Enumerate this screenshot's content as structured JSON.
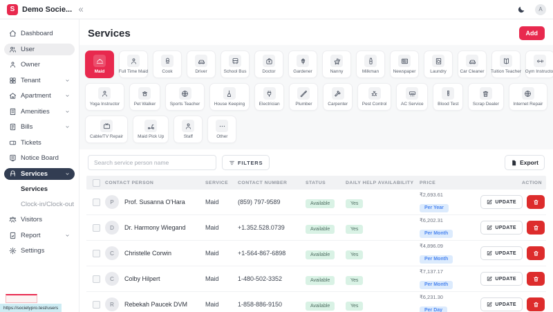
{
  "colors": {
    "brand": "#e8294e",
    "navy": "#323d52",
    "del": "#dd2c2c",
    "green_bg": "#d9f2e5",
    "green_tx": "#4f6e62",
    "blue_bg": "#dcebfd",
    "blue_tx": "#4c86f0",
    "tooltip_bg": "#cdecf3",
    "header_bg": "#f1f2f4"
  },
  "topbar": {
    "logo_letter": "S",
    "app_name": "Demo Socie...",
    "avatar_initial": "A"
  },
  "sidebar": {
    "items": [
      {
        "label": "Dashboard",
        "glyph": "i-home"
      },
      {
        "label": "User",
        "glyph": "i-users",
        "state": "highlight"
      },
      {
        "label": "Owner",
        "glyph": "i-user"
      },
      {
        "label": "Tenant",
        "glyph": "i-grid",
        "chevron": true
      },
      {
        "label": "Apartment",
        "glyph": "i-house",
        "chevron": true
      },
      {
        "label": "Amenities",
        "glyph": "i-building",
        "chevron": true
      },
      {
        "label": "Bills",
        "glyph": "i-doc",
        "chevron": true
      },
      {
        "label": "Tickets",
        "glyph": "i-ticket"
      },
      {
        "label": "Notice Board",
        "glyph": "i-board"
      },
      {
        "label": "Services",
        "glyph": "i-bench",
        "chevron": true,
        "state": "active",
        "children": [
          {
            "label": "Services",
            "active": true
          },
          {
            "label": "Clock-in/Clock-out"
          }
        ]
      },
      {
        "label": "Visitors",
        "glyph": "i-visitors"
      },
      {
        "label": "Report",
        "glyph": "i-report",
        "chevron": true
      },
      {
        "label": "Settings",
        "glyph": "i-gear"
      }
    ],
    "url_tooltip": "https://societypro.test/users"
  },
  "page": {
    "title": "Services",
    "add_button": "Add"
  },
  "service_tiles": {
    "active": "Maid",
    "rows": [
      [
        {
          "label": "Maid",
          "glyph": "i-cloche",
          "active": true
        },
        {
          "label": "Full Time Maid",
          "glyph": "i-user"
        },
        {
          "label": "Cook",
          "glyph": "i-hat"
        },
        {
          "label": "Driver",
          "glyph": "i-car"
        },
        {
          "label": "School Bus",
          "glyph": "i-bus"
        },
        {
          "label": "Doctor",
          "glyph": "i-bag"
        },
        {
          "label": "Gardener",
          "glyph": "i-flower"
        },
        {
          "label": "Nanny",
          "glyph": "i-pram"
        },
        {
          "label": "Milkman",
          "glyph": "i-bottle"
        },
        {
          "label": "Newspaper",
          "glyph": "i-news"
        },
        {
          "label": "Laundry",
          "glyph": "i-washer"
        },
        {
          "label": "Car Cleaner",
          "glyph": "i-car"
        },
        {
          "label": "Tuition Teacher",
          "glyph": "i-book"
        },
        {
          "label": "Gym Instructor",
          "glyph": "i-dumbbell"
        }
      ],
      [
        {
          "label": "Yoga Instructor",
          "glyph": "i-user"
        },
        {
          "label": "Pet Walker",
          "glyph": "i-paw"
        },
        {
          "label": "Sports Teacher",
          "glyph": "i-globe"
        },
        {
          "label": "House Keeping",
          "glyph": "i-broom"
        },
        {
          "label": "Electrician",
          "glyph": "i-plug"
        },
        {
          "label": "Plumber",
          "glyph": "i-wrench"
        },
        {
          "label": "Carpenter",
          "glyph": "i-hammer"
        },
        {
          "label": "Pest Control",
          "glyph": "i-bug"
        },
        {
          "label": "AC Service",
          "glyph": "i-ac"
        },
        {
          "label": "Blood Test",
          "glyph": "i-tube"
        },
        {
          "label": "Scrap Dealer",
          "glyph": "i-bin"
        },
        {
          "label": "Internet Repair",
          "glyph": "i-globe"
        }
      ],
      [
        {
          "label": "Cable/TV Repair",
          "glyph": "i-tv"
        },
        {
          "label": "Maid Pick Up",
          "glyph": "i-scooter"
        },
        {
          "label": "Staff",
          "glyph": "i-user"
        },
        {
          "label": "Other",
          "glyph": "i-dots"
        }
      ]
    ]
  },
  "toolbar": {
    "search_placeholder": "Search service person name",
    "filters_label": "FILTERS",
    "export_label": "Export"
  },
  "table": {
    "headers": [
      "CONTACT PERSON",
      "SERVICE",
      "CONTACT NUMBER",
      "STATUS",
      "DAILY HELP AVAILABILITY",
      "PRICE",
      "ACTION"
    ],
    "update_label": "UPDATE",
    "rows": [
      {
        "initial": "P",
        "name": "Prof. Susanna O'Hara",
        "service": "Maid",
        "contact": "(859) 797-9589",
        "status": "Available",
        "daily_help": "Yes",
        "price": "₹2,693.61",
        "period": "Per Year"
      },
      {
        "initial": "D",
        "name": "Dr. Harmony Wiegand",
        "service": "Maid",
        "contact": "+1.352.528.0739",
        "status": "Available",
        "daily_help": "Yes",
        "price": "₹6,202.31",
        "period": "Per Month"
      },
      {
        "initial": "C",
        "name": "Christelle Corwin",
        "service": "Maid",
        "contact": "+1-564-867-6898",
        "status": "Available",
        "daily_help": "Yes",
        "price": "₹4,896.09",
        "period": "Per Month"
      },
      {
        "initial": "C",
        "name": "Colby Hilpert",
        "service": "Maid",
        "contact": "1-480-502-3352",
        "status": "Available",
        "daily_help": "Yes",
        "price": "₹7,137.17",
        "period": "Per Month"
      },
      {
        "initial": "R",
        "name": "Rebekah Paucek DVM",
        "service": "Maid",
        "contact": "1-858-886-9150",
        "status": "Available",
        "daily_help": "Yes",
        "price": "₹6,231.30",
        "period": "Per Day"
      }
    ]
  }
}
